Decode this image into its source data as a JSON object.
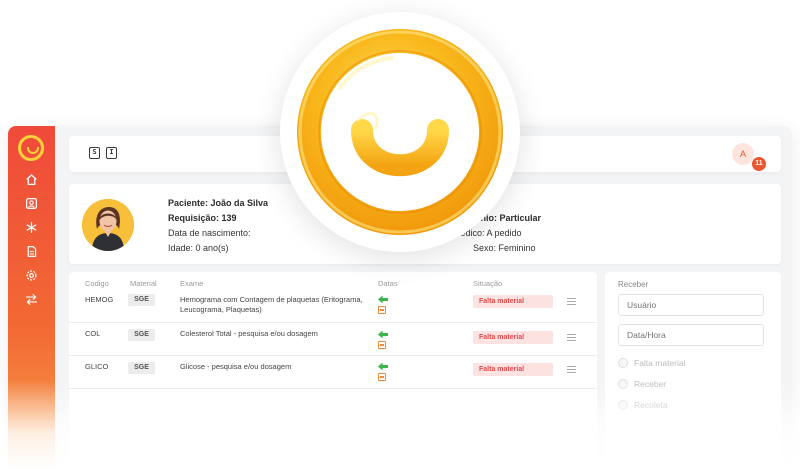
{
  "topbar": {
    "icon_s": "S",
    "icon_i": "I",
    "avatar_initial": "A",
    "notification_count": "11"
  },
  "sidebar": {
    "items": [
      {
        "icon": "home-icon"
      },
      {
        "icon": "user-card-icon"
      },
      {
        "icon": "asterisk-icon"
      },
      {
        "icon": "document-icon"
      },
      {
        "icon": "gear-icon"
      },
      {
        "icon": "transfer-icon"
      }
    ]
  },
  "patient": {
    "name": "Paciente: João da Silva",
    "requisition": "Requisição: 139",
    "birth": "Data de nascimento:",
    "age": "Idade: 0 ano(s)",
    "insurance": "Convênio: Particular",
    "doctor": "Médico: A pedido",
    "sex": "Sexo: Feminino"
  },
  "table": {
    "headers": {
      "code": "Codigo",
      "material": "Material",
      "exam": "Exame",
      "dates": "Datas",
      "status": "Situação"
    },
    "rows": [
      {
        "code": "HEMOG",
        "material": "SGE",
        "exam_line1": "Hemograma com Contagem de plaquetas (Eritograma,",
        "exam_line2": "Leucograma, Plaquetas)",
        "status": "Falta material"
      },
      {
        "code": "COL",
        "material": "SGE",
        "exam_line1": "Colesterol Total - pesquisa e/ou dosagem",
        "exam_line2": "",
        "status": "Falta material"
      },
      {
        "code": "GLICO",
        "material": "SGE",
        "exam_line1": "Glicose - pesquisa e/ou dosagem",
        "exam_line2": "",
        "status": "Falta material"
      }
    ]
  },
  "receive_panel": {
    "title": "Receber",
    "user_placeholder": "Usuário",
    "datetime_placeholder": "Data/Hora",
    "options": [
      "Falta material",
      "Receber",
      "Recoleta"
    ]
  },
  "colors": {
    "accent": "#e8572f",
    "logo": "#f8b51e",
    "status_bg": "#fde2e2",
    "status_text": "#e04a4a"
  }
}
